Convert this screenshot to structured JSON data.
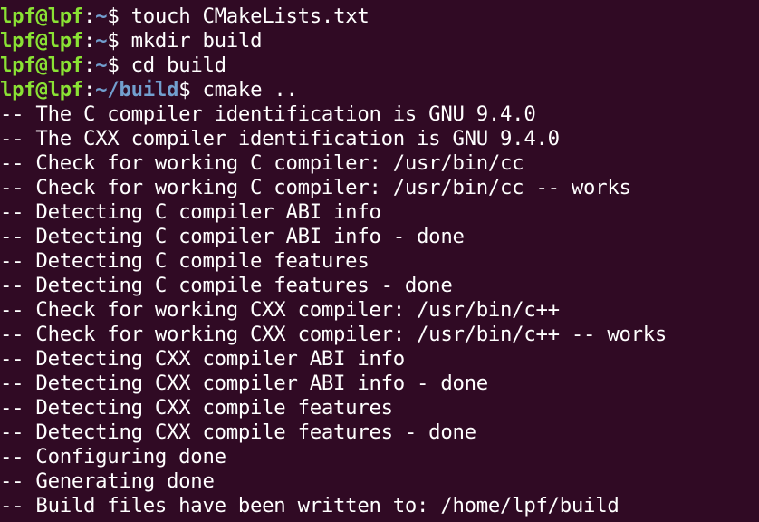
{
  "prompt_lines": [
    {
      "user": "lpf@lpf",
      "path": "~",
      "symbol": "$",
      "command": " touch CMakeLists.txt"
    },
    {
      "user": "lpf@lpf",
      "path": "~",
      "symbol": "$",
      "command": " mkdir build"
    },
    {
      "user": "lpf@lpf",
      "path": "~",
      "symbol": "$",
      "command": " cd build"
    },
    {
      "user": "lpf@lpf",
      "path": "~/build",
      "symbol": "$",
      "command": " cmake .."
    }
  ],
  "output_lines": [
    "-- The C compiler identification is GNU 9.4.0",
    "-- The CXX compiler identification is GNU 9.4.0",
    "-- Check for working C compiler: /usr/bin/cc",
    "-- Check for working C compiler: /usr/bin/cc -- works",
    "-- Detecting C compiler ABI info",
    "-- Detecting C compiler ABI info - done",
    "-- Detecting C compile features",
    "-- Detecting C compile features - done",
    "-- Check for working CXX compiler: /usr/bin/c++",
    "-- Check for working CXX compiler: /usr/bin/c++ -- works",
    "-- Detecting CXX compiler ABI info",
    "-- Detecting CXX compiler ABI info - done",
    "-- Detecting CXX compile features",
    "-- Detecting CXX compile features - done",
    "-- Configuring done",
    "-- Generating done",
    "-- Build files have been written to: /home/lpf/build"
  ],
  "colors": {
    "background": "#300a24",
    "text": "#ffffff",
    "user": "#8ae234",
    "path": "#729fcf"
  }
}
